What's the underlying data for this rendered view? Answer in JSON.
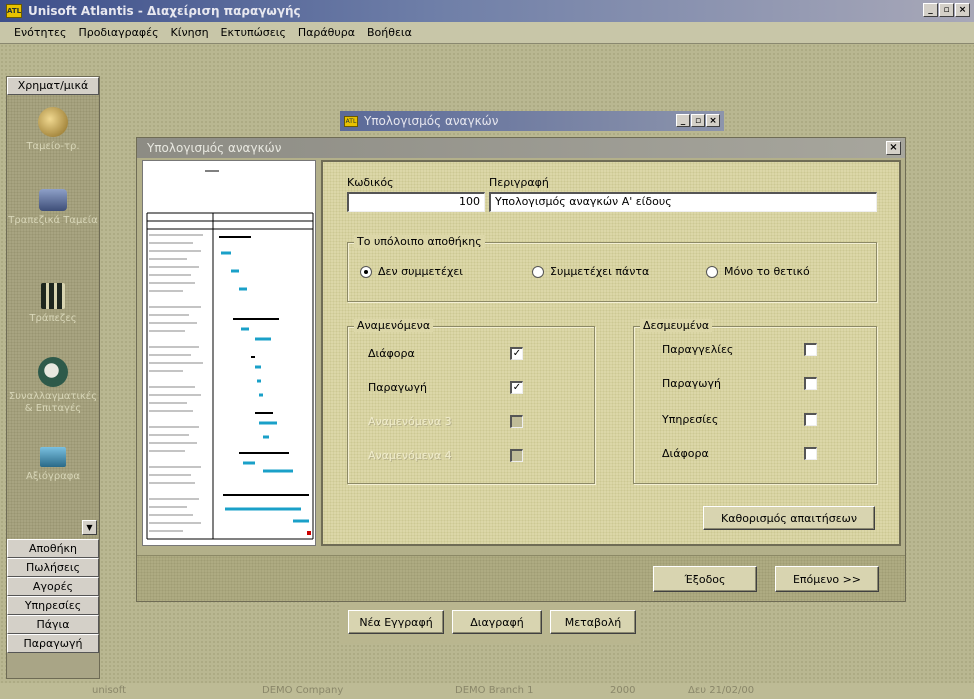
{
  "window": {
    "title": "Unisoft Atlantis - Διαχείριση παραγωγής",
    "icon_text": "ATL",
    "minimize": "_",
    "maximize": "▫",
    "close": "×"
  },
  "menu": [
    "Ενότητες",
    "Προδιαγραφές",
    "Κίνηση",
    "Εκτυπώσεις",
    "Παράθυρα",
    "Βοήθεια"
  ],
  "outlook": {
    "header": "Χρηματ/μικά",
    "items": [
      {
        "label": "Ταμείο-τρ.",
        "icon": "globe-icon",
        "color": "#c8b070"
      },
      {
        "label": "Τραπεζικά Ταμεία",
        "icon": "money-icon",
        "color": "#6a7ca8"
      },
      {
        "label": "Τράπεζες",
        "icon": "bank-icon",
        "color": "#2e3a2e"
      },
      {
        "label": "Συναλλαγματικές & Επιταγές",
        "icon": "check-icon",
        "color": "#3a6a5a"
      },
      {
        "label": "Αξιόγραφα",
        "icon": "document-icon",
        "color": "#4a8aa8"
      }
    ],
    "scroll_glyph": "▼",
    "sections": [
      "Αποθήκη",
      "Πωλήσεις",
      "Αγορές",
      "Υπηρεσίες",
      "Πάγια",
      "Παραγωγή"
    ]
  },
  "back_window": {
    "title": "Υπολογισμός αναγκών",
    "buttons": [
      "Νέα Εγγραφή",
      "Διαγραφή",
      "Μεταβολή"
    ]
  },
  "dialog": {
    "title": "Υπολογισμός αναγκών",
    "close": "×",
    "code_label": "Κωδικός",
    "code_value": "100",
    "desc_label": "Περιγραφή",
    "desc_value": "Υπολογισμός αναγκών Α' είδους",
    "stock_group": "Το υπόλοιπο αποθήκης",
    "stock_options": [
      {
        "label": "Δεν συμμετέχει",
        "selected": true
      },
      {
        "label": "Συμμετέχει πάντα",
        "selected": false
      },
      {
        "label": "Μόνο το θετικό",
        "selected": false
      }
    ],
    "expected_group": "Αναμενόμενα",
    "expected": [
      {
        "label": "Διάφορα",
        "checked": true,
        "enabled": true
      },
      {
        "label": "Παραγωγή",
        "checked": true,
        "enabled": true
      },
      {
        "label": "Αναμενόμενα 3",
        "checked": false,
        "enabled": false
      },
      {
        "label": "Αναμενόμενα 4",
        "checked": false,
        "enabled": false
      }
    ],
    "reserved_group": "Δεσμευμένα",
    "reserved": [
      {
        "label": "Παραγγελίες",
        "checked": false
      },
      {
        "label": "Παραγωγή",
        "checked": false
      },
      {
        "label": "Υπηρεσίες",
        "checked": false
      },
      {
        "label": "Διάφορα",
        "checked": false
      }
    ],
    "requirements_button": "Καθορισμός απαιτήσεων",
    "exit_button": "Έξοδος",
    "next_button": "Επόμενο >>"
  },
  "status": {
    "user": "unisoft",
    "company": "DEMO Company",
    "branch": "DEMO Branch 1",
    "year": "2000",
    "date": "Δευ 21/02/00"
  }
}
